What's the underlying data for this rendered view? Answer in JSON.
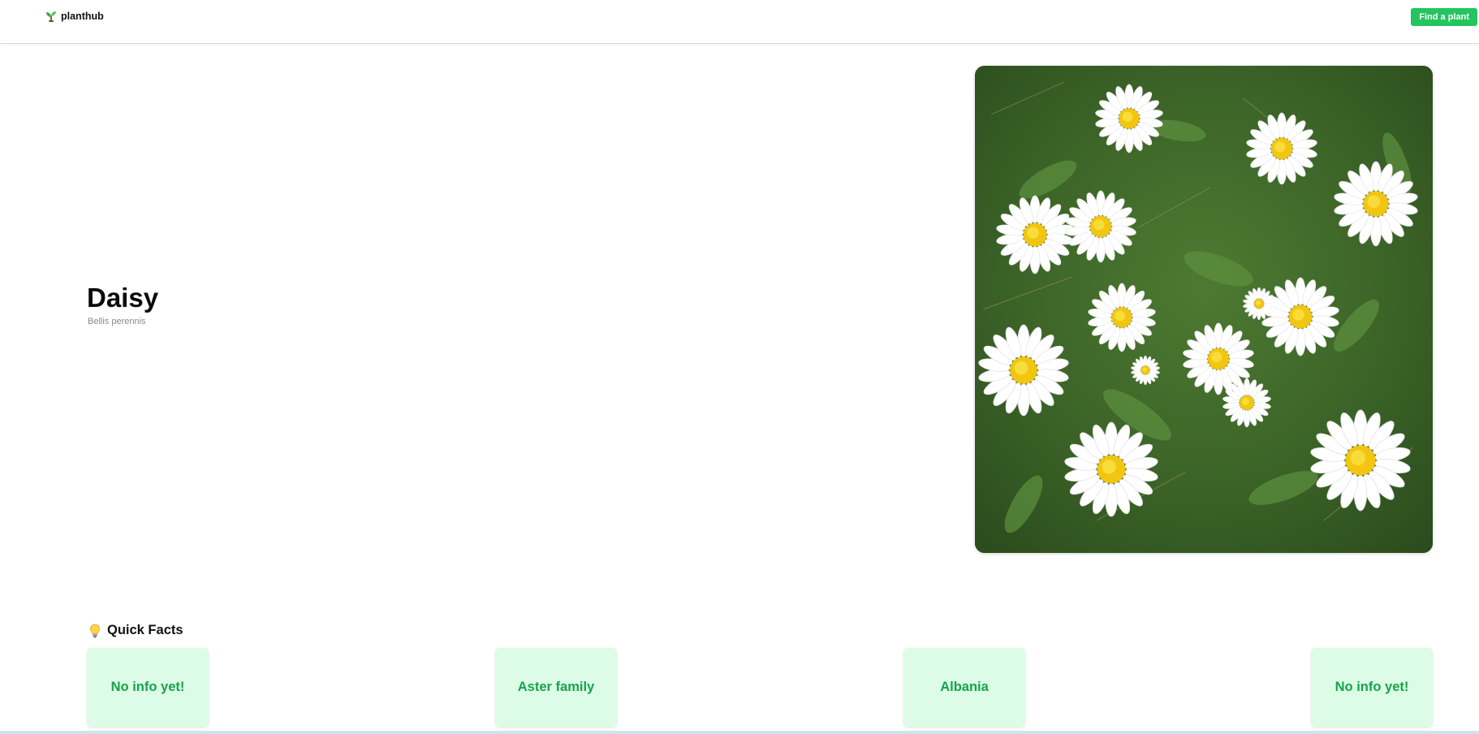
{
  "header": {
    "brand": "planthub",
    "brand_icon": "sprout-icon",
    "find_button": "Find a plant"
  },
  "plant": {
    "name": "Daisy",
    "scientific_name": "Bellis perennis",
    "photo_alt": "Daisy"
  },
  "quick_facts": {
    "heading": "Quick Facts",
    "heading_icon": "lightbulb-icon",
    "items": [
      {
        "value": "No info yet!"
      },
      {
        "value": "Aster family"
      },
      {
        "value": "Albania"
      },
      {
        "value": "No info yet!"
      }
    ]
  },
  "colors": {
    "accent": "#22c55e",
    "fact_bg": "#dcfce7",
    "fact_text": "#16a34a"
  }
}
